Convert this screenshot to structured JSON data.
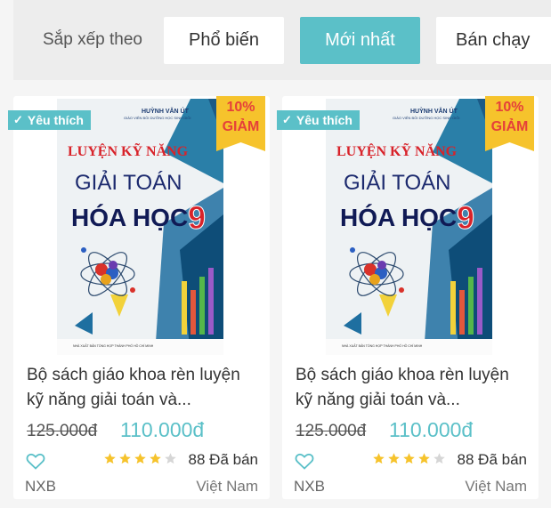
{
  "sort": {
    "label": "Sắp xếp theo",
    "options": [
      "Phổ biến",
      "Mới nhất",
      "Bán chạy"
    ],
    "active": "Mới nhất"
  },
  "colors": {
    "accent": "#5bc0c8",
    "discount_bg": "#f6c32c",
    "discount_text": "#e5403a",
    "star": "#f6c32c"
  },
  "cover": {
    "author": "HUỲNH VĂN ÚT",
    "author_sub": "GIÁO VIÊN BỒI DƯỠNG HỌC SINH GIỎI",
    "line1": "LUYỆN KỸ NĂNG",
    "line2": "GIẢI TOÁN",
    "line3": "HÓA HỌC",
    "grade": "9",
    "publisher_line": "NHÀ XUẤT BẢN TỔNG HỢP THÀNH PHỐ HỒ CHÍ MINH"
  },
  "products": [
    {
      "badge_fav": "Yêu thích",
      "discount_pct": "10%",
      "discount_word": "GIẢM",
      "title": "Bộ sách giáo khoa rèn luyện kỹ năng giải toán và...",
      "old_price": "125.000đ",
      "price": "110.000đ",
      "rating": 4,
      "sold": "88 Đã bán",
      "publisher": "NXB",
      "origin": "Việt Nam"
    },
    {
      "badge_fav": "Yêu thích",
      "discount_pct": "10%",
      "discount_word": "GIẢM",
      "title": "Bộ sách giáo khoa rèn luyện kỹ năng giải toán và...",
      "old_price": "125.000đ",
      "price": "110.000đ",
      "rating": 4,
      "sold": "88 Đã bán",
      "publisher": "NXB",
      "origin": "Việt Nam"
    }
  ]
}
